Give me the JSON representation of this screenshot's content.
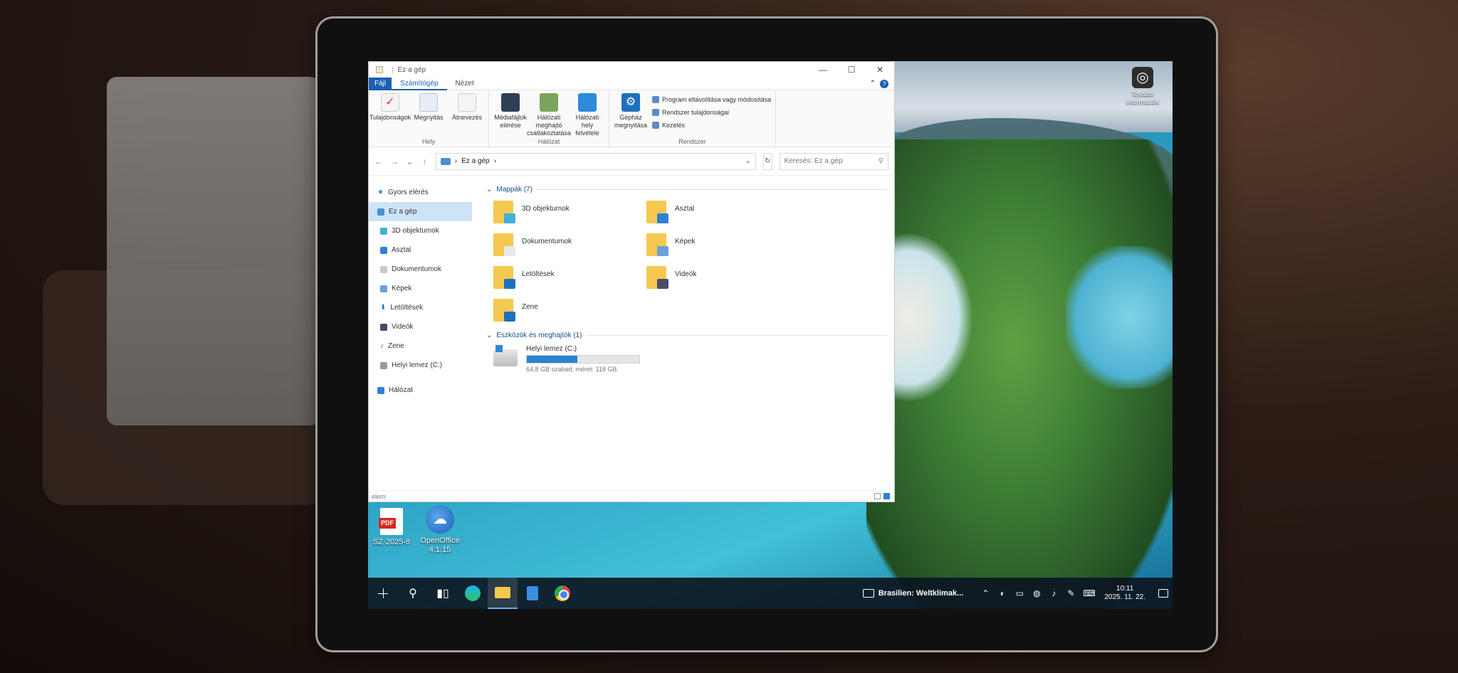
{
  "explorer": {
    "title": "Ez a gép",
    "ribbon_tabs": [
      "Fájl",
      "Számítógép",
      "Nézet"
    ],
    "ribbon": {
      "hely": {
        "label": "Hely",
        "buttons": [
          "Tulajdonságok",
          "Megnyitás",
          "Átnevezés"
        ]
      },
      "halozat": {
        "label": "Hálózat",
        "buttons": [
          "Médiafájlok elérése",
          "Hálózati meghajtó csatlakoztatása",
          "Hálózati hely felvétele"
        ]
      },
      "rendszer": {
        "label": "Rendszer",
        "buttons": [
          "Gépház megnyitása"
        ],
        "small": [
          "Program eltávolítása vagy módosítása",
          "Rendszer tulajdonságai",
          "Kezelés"
        ]
      }
    },
    "address": {
      "path": "Ez a gép",
      "search_placeholder": "Keresés: Ez a gép"
    },
    "nav": {
      "quick_access": "Gyors elérés",
      "this_pc": "Ez a gép",
      "items": [
        "3D objektumok",
        "Asztal",
        "Dokumentumok",
        "Képek",
        "Letöltések",
        "Videók",
        "Zene",
        "Helyi lemez (C:)"
      ],
      "network": "Hálózat"
    },
    "folders_header": "Mappák (7)",
    "folders": [
      "3D objektumok",
      "Asztal",
      "Dokumentumok",
      "Képek",
      "Letöltések",
      "Videók",
      "Zene"
    ],
    "devices_header": "Eszközök és meghajtók (1)",
    "drive": {
      "name": "Helyi lemez (C:)",
      "free_text": "64,8 GB szabad, méret: 118 GB",
      "used_fraction": 0.45
    },
    "status": "elem"
  },
  "desktop": {
    "widget_label": "További információk",
    "icons": [
      {
        "label": "SZ-2025-8",
        "badge": "PDF"
      },
      {
        "label": "OpenOffice 4.1.15"
      }
    ]
  },
  "taskbar": {
    "news": "Brasilien: Weltklimak...",
    "time": "10:11",
    "date": "2025. 11. 22."
  },
  "colors": {
    "accent": "#1a5fb4",
    "folder": "#f5c94f",
    "drive_fill": "#2b82d6",
    "selection": "#cde4f7"
  }
}
